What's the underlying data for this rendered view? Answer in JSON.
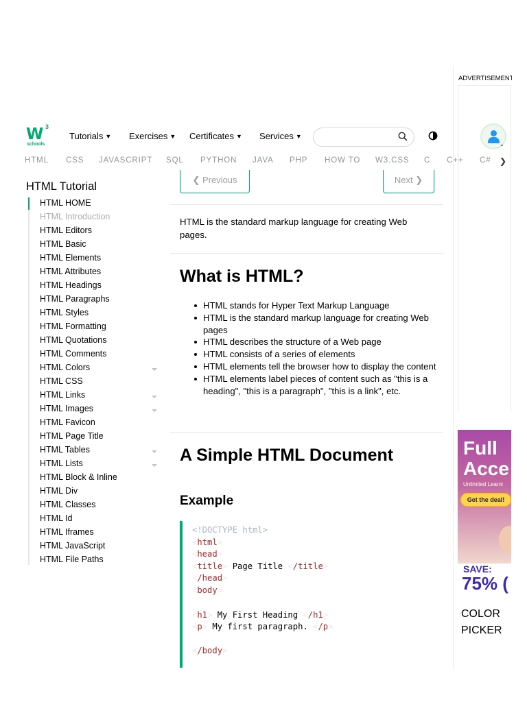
{
  "header": {
    "logo_main": "w3",
    "logo_sup": "3",
    "logo_sub": "schools",
    "menus": [
      "Tutorials",
      "Exercises",
      "Certificates",
      "Services"
    ],
    "search_placeholder": ""
  },
  "subnav": [
    "HTML",
    "CSS",
    "JAVASCRIPT",
    "SQL",
    "PYTHON",
    "JAVA",
    "PHP",
    "HOW TO",
    "W3.CSS",
    "C",
    "C++",
    "C#"
  ],
  "sidebar": {
    "title": "HTML Tutorial",
    "items": [
      "HTML HOME",
      "HTML Introduction",
      "HTML Editors",
      "HTML Basic",
      "HTML Elements",
      "HTML Attributes",
      "HTML Headings",
      "HTML Paragraphs",
      "HTML Styles",
      "HTML Formatting",
      "HTML Quotations",
      "HTML Comments",
      "HTML Colors",
      "HTML CSS",
      "HTML Links",
      "HTML Images",
      "HTML Favicon",
      "HTML Page Title",
      "HTML Tables",
      "HTML Lists",
      "HTML Block & Inline",
      "HTML Div",
      "HTML Classes",
      "HTML Id",
      "HTML Iframes",
      "HTML JavaScript",
      "HTML File Paths"
    ]
  },
  "main": {
    "prev_label": "❮ Previous",
    "next_label": "Next ❯",
    "intro": "HTML is the standard markup language for creating Web pages.",
    "what_heading": "What is HTML?",
    "bullets": [
      "HTML stands for Hyper Text Markup Language",
      "HTML is the standard markup language for creating Web pages",
      "HTML describes the structure of a Web page",
      "HTML consists of a series of elements",
      "HTML elements tell the browser how to display the content",
      "HTML elements label pieces of content such as \"this is a heading\", \"this is a paragraph\", \"this is a link\", etc."
    ],
    "doc_heading": "A Simple HTML Document",
    "example_heading": "Example",
    "code": {
      "doctype": "<!DOCTYPE html>",
      "html": "html",
      "head": "head",
      "title_open": "title",
      "title_text": " Page Title ",
      "title_close": "/title",
      "head_close": "/head",
      "body": "body",
      "h1_open": "h1",
      "h1_text": " My First Heading ",
      "h1_close": "/h1",
      "p_open": "p",
      "p_text": " My first paragraph. ",
      "p_close": "/p",
      "body_close": "/body"
    }
  },
  "ads": {
    "label": "ADVERTISEMENT",
    "promo_title_1": "Full",
    "promo_title_2": "Acce",
    "promo_sub": "Unlimited Learni",
    "promo_button": "Get the deal!",
    "save": "SAVE:",
    "percent": "75% (",
    "color_picker": "COLOR PICKER"
  },
  "colors": {
    "accent": "#04aa6d",
    "code_keyword": "#a52a2a"
  }
}
